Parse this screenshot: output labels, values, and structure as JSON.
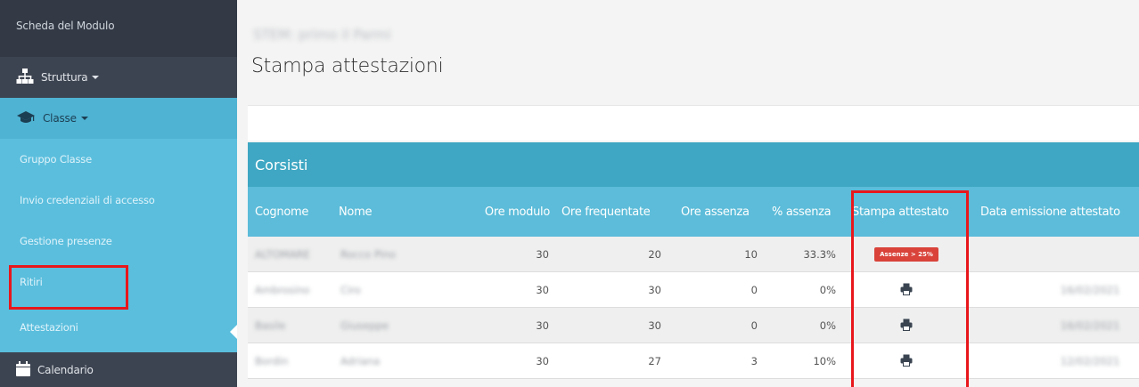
{
  "sidebar": {
    "top_label": "Scheda del Modulo",
    "items": [
      {
        "label": "Struttura"
      },
      {
        "label": "Classe"
      },
      {
        "label": "Gruppo Classe"
      },
      {
        "label": "Invio credenziali di accesso"
      },
      {
        "label": "Gestione presenze"
      },
      {
        "label": "Ritiri"
      },
      {
        "label": "Attestazioni"
      },
      {
        "label": "Calendario"
      }
    ]
  },
  "breadcrumb": "STEM: primo il Parmi",
  "page_title": "Stampa attestazioni",
  "panel_title": "Corsisti",
  "table": {
    "headers": [
      "Cognome",
      "Nome",
      "Ore modulo",
      "Ore frequentate",
      "Ore assenza",
      "% assenza",
      "Stampa attestato",
      "Data emissione attestato"
    ],
    "rows": [
      {
        "cognome": "ALTOMARE",
        "nome": "Rocco Pino",
        "ore_modulo": "30",
        "ore_frequentate": "20",
        "ore_assenza": "10",
        "perc_assenza": "33.3%",
        "stampa": "badge",
        "badge_label": "Assenze > 25%",
        "data": ""
      },
      {
        "cognome": "Ambrosino",
        "nome": "Ciro",
        "ore_modulo": "30",
        "ore_frequentate": "30",
        "ore_assenza": "0",
        "perc_assenza": "0%",
        "stampa": "print",
        "badge_label": "",
        "data": "16/02/2021"
      },
      {
        "cognome": "Basile",
        "nome": "Giuseppe",
        "ore_modulo": "30",
        "ore_frequentate": "30",
        "ore_assenza": "0",
        "perc_assenza": "0%",
        "stampa": "print",
        "badge_label": "",
        "data": "16/02/2021"
      },
      {
        "cognome": "Bordin",
        "nome": "Adriana",
        "ore_modulo": "30",
        "ore_frequentate": "27",
        "ore_assenza": "3",
        "perc_assenza": "10%",
        "stampa": "print",
        "badge_label": "",
        "data": "12/02/2021"
      }
    ]
  },
  "icons": {
    "struttura": "sitemap-icon",
    "classe": "graduation-cap-icon",
    "calendario": "calendar-icon",
    "stampa": "print-icon"
  },
  "colors": {
    "sidebar_dark": "#3d4451",
    "sidebar_active": "#5bbedd",
    "panel_header": "#3fa7c3",
    "table_header": "#5cbcd9",
    "badge_red": "#d9433a",
    "highlight_red": "#e8171b"
  }
}
